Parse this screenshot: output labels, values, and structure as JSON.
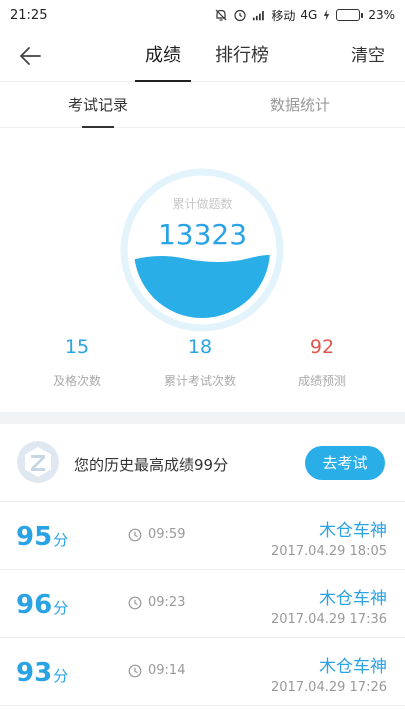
{
  "status_bar": {
    "time": "21:25",
    "carrier": "移动",
    "network": "4G",
    "battery_percent": "23%",
    "battery_level": 0.23,
    "icons": [
      "mute-icon",
      "alarm-icon",
      "signal-icon",
      "charging-icon",
      "battery-icon"
    ]
  },
  "nav": {
    "back_icon": "arrow-left-icon",
    "tab_score": "成绩",
    "tab_ranking": "排行榜",
    "clear": "清空"
  },
  "subtabs": {
    "records": "考试记录",
    "stats": "数据统计"
  },
  "summary": {
    "gauge_label": "累计做题数",
    "gauge_value": "13323",
    "pass_count": "15",
    "pass_label": "及格次数",
    "exam_count": "18",
    "exam_label": "累计考试次数",
    "prediction": "92",
    "prediction_label": "成绩预测"
  },
  "best": {
    "text": "您的历史最高成绩99分",
    "button": "去考试"
  },
  "records": [
    {
      "score": "95",
      "unit": "分",
      "duration": "09:59",
      "name": "木仓车神",
      "date": "2017.04.29  18:05"
    },
    {
      "score": "96",
      "unit": "分",
      "duration": "09:23",
      "name": "木仓车神",
      "date": "2017.04.29  17:36"
    },
    {
      "score": "93",
      "unit": "分",
      "duration": "09:14",
      "name": "木仓车神",
      "date": "2017.04.29  17:26"
    }
  ],
  "colors": {
    "accent": "#2aa3e4",
    "button": "#2aaee8",
    "prediction": "#e2574c",
    "battery": "#27c24c"
  }
}
